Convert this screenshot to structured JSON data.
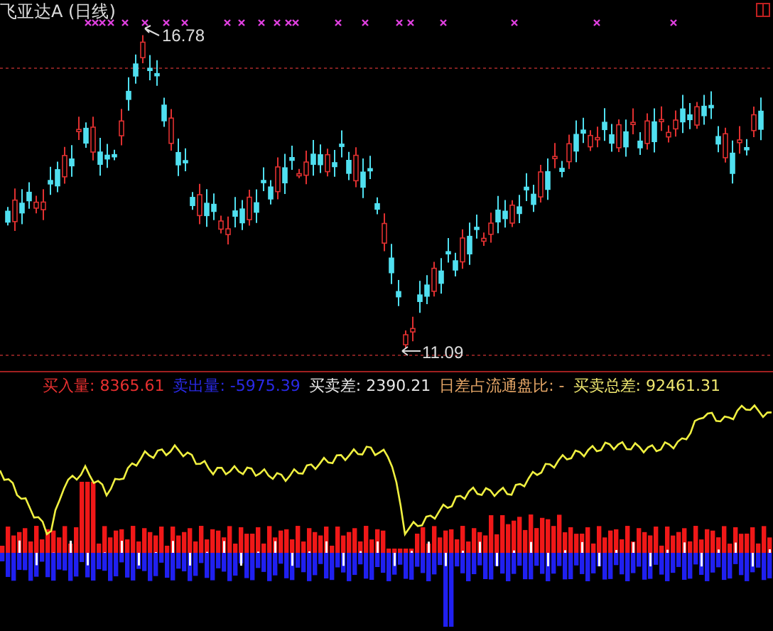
{
  "title": {
    "name": "飞亚达A",
    "period": "(日线)"
  },
  "price_chart": {
    "high_label": "16.78",
    "low_label": "11.09"
  },
  "indicator": {
    "items": [
      {
        "label": "买入量:",
        "value": "8365.61",
        "color": "#e83030"
      },
      {
        "label": "卖出量:",
        "value": "-5975.39",
        "color": "#2a2ae8"
      },
      {
        "label": "买卖差:",
        "value": "2390.21",
        "color": "#e8e8e8"
      },
      {
        "label": "日差占流通盘比:",
        "value": "-",
        "color": "#e8a868"
      },
      {
        "label": "买卖总差:",
        "value": "92461.31",
        "color": "#f0e870"
      }
    ]
  }
}
